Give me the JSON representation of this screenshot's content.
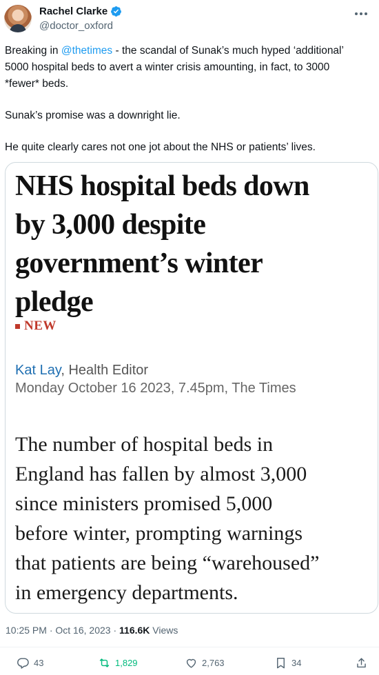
{
  "author": {
    "display_name": "Rachel Clarke",
    "handle": "@doctor_oxford",
    "verified": true
  },
  "tweet": {
    "line1_prefix": "Breaking in ",
    "mention": "@thetimes",
    "line1_suffix": " - the scandal of Sunak’s much hyped ‘additional’",
    "line2": "5000 hospital beds to avert a winter crisis amounting, in fact, to 3000",
    "line3": "*fewer* beds.",
    "para2": "Sunak’s promise was a downright lie.",
    "para3": "He quite clearly cares not one jot about the NHS or patients’ lives."
  },
  "article": {
    "headline_line1": "NHS hospital beds down",
    "headline_line2": "by 3,000 despite",
    "headline_line3": "government’s winter",
    "headline_line4": "pledge",
    "tag": "NEW",
    "author": "Kat Lay",
    "author_role": ", Health Editor",
    "dateline": "Monday October 16 2023, 7.45pm, The Times",
    "lede_line1": "The number of hospital beds in",
    "lede_line2": "England has fallen by almost 3,000",
    "lede_line3": "since ministers promised 5,000",
    "lede_line4": "before winter, prompting warnings",
    "lede_line5": "that patients are being “warehoused”",
    "lede_line6": "in emergency departments."
  },
  "meta": {
    "time": "10:25 PM",
    "separator": " · ",
    "date": "Oct 16, 2023",
    "views_count": "116.6K",
    "views_label": " Views"
  },
  "actions": {
    "replies": "43",
    "retweets": "1,829",
    "likes": "2,763",
    "bookmarks": "34"
  },
  "colors": {
    "accent": "#1d9bf0",
    "retweet": "#00ba7c",
    "tag_red": "#c0392b",
    "byline_blue": "#1f6fb2"
  },
  "icons": [
    "avatar",
    "verified-badge-icon",
    "more-options-icon",
    "reply-icon",
    "retweet-icon",
    "like-icon",
    "bookmark-icon",
    "share-icon"
  ]
}
